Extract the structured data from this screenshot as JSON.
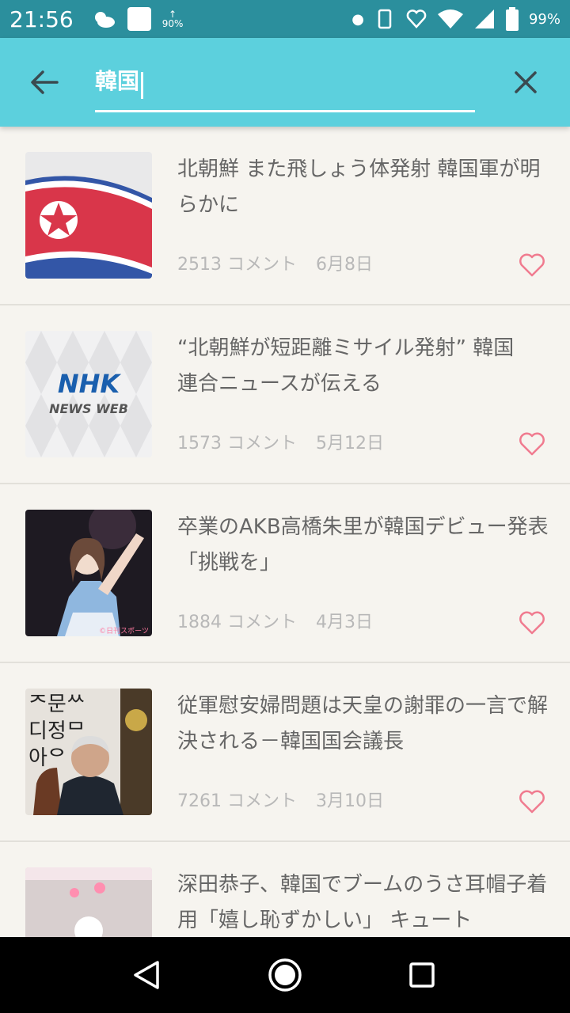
{
  "status_bar": {
    "time": "21:56",
    "upload_percent": "90%",
    "battery": "99%"
  },
  "search": {
    "query": "韓国"
  },
  "articles": [
    {
      "title": "北朝鮮 また飛しょう体発射 韓国軍が明らかに",
      "comments": "2513 コメント",
      "date": "6月8日"
    },
    {
      "title": "“北朝鮮が短距離ミサイル発射” 韓国　連合ニュースが伝える",
      "comments": "1573 コメント",
      "date": "5月12日",
      "thumb_logo": "NHK",
      "thumb_sub": "NEWS WEB"
    },
    {
      "title": "卒業のAKB高橋朱里が韓国デビュー発表「挑戦を」",
      "comments": "1884 コメント",
      "date": "4月3日"
    },
    {
      "title": "従軍慰安婦問題は天皇の謝罪の一言で解決される－韓国国会議長",
      "comments": "7261 コメント",
      "date": "3月10日"
    },
    {
      "title": "深田恭子、韓国でブームのうさ耳帽子着用「嬉し恥ずかしい」 キュート",
      "comments": "",
      "date": ""
    }
  ],
  "colors": {
    "accent": "#5cd0dd",
    "heart": "#f07b8f"
  }
}
